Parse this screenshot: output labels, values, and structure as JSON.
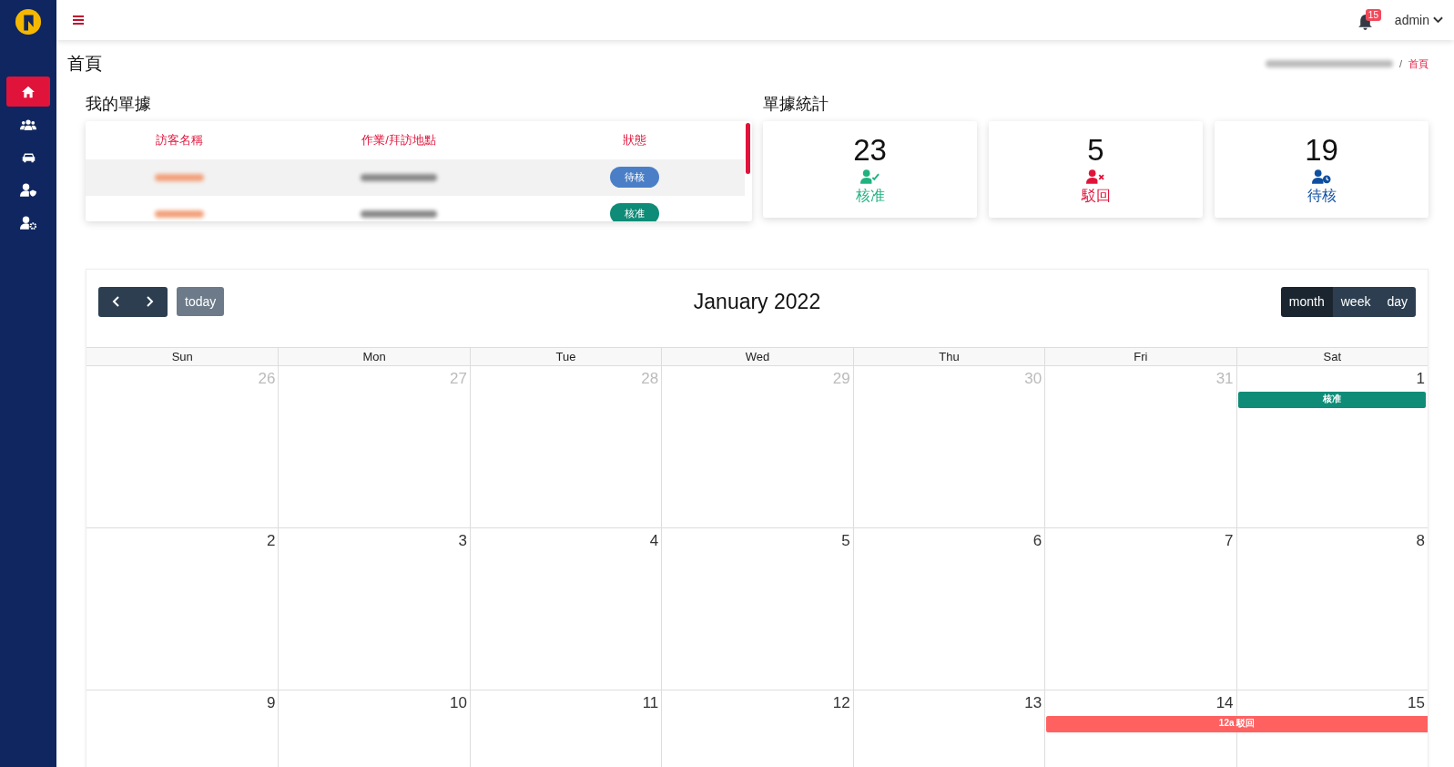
{
  "topbar": {
    "notifications": "15",
    "user": "admin"
  },
  "sidebar": {
    "items": [
      {
        "kind": "home",
        "selected": true
      },
      {
        "kind": "users",
        "selected": false
      },
      {
        "kind": "car",
        "selected": false
      },
      {
        "kind": "shield",
        "selected": false
      },
      {
        "kind": "gear",
        "selected": false
      }
    ]
  },
  "page": {
    "title": "首頁",
    "breadcrumb_separator": "/",
    "breadcrumb_current": "首頁"
  },
  "my_forms": {
    "title": "我的單據",
    "columns": [
      "訪客名稱",
      "作業/拜訪地點",
      "狀態"
    ],
    "rows": [
      {
        "status": "待核",
        "color": "#4a7fc8"
      },
      {
        "status": "核准",
        "color": "#0e8c78"
      }
    ]
  },
  "stats": {
    "title": "單據統計",
    "cards": [
      {
        "value": "23",
        "label": "核准",
        "kind": "approved",
        "color": "#20b27f"
      },
      {
        "value": "5",
        "label": "駁回",
        "kind": "rejected",
        "color": "#e0133a"
      },
      {
        "value": "19",
        "label": "待核",
        "kind": "pending",
        "color": "#0f4fa0"
      }
    ]
  },
  "calendar": {
    "title": "January 2022",
    "today": "today",
    "views": [
      {
        "label": "month",
        "selected": true
      },
      {
        "label": "week",
        "selected": false
      },
      {
        "label": "day",
        "selected": false
      }
    ],
    "weekdays": [
      "Sun",
      "Mon",
      "Tue",
      "Wed",
      "Thu",
      "Fri",
      "Sat"
    ],
    "weeks": [
      {
        "days": [
          {
            "day": "26",
            "muted": true
          },
          {
            "day": "27",
            "muted": true
          },
          {
            "day": "28",
            "muted": true
          },
          {
            "day": "29",
            "muted": true
          },
          {
            "day": "30",
            "muted": true
          },
          {
            "day": "31",
            "muted": true
          },
          {
            "day": "1",
            "muted": false,
            "events": [
              {
                "title": "核准",
                "spans_next_day": false,
                "color": "#0e8c78"
              }
            ]
          }
        ]
      },
      {
        "days": [
          {
            "day": "2",
            "muted": false
          },
          {
            "day": "3",
            "muted": false
          },
          {
            "day": "4",
            "muted": false
          },
          {
            "day": "5",
            "muted": false
          },
          {
            "day": "6",
            "muted": false
          },
          {
            "day": "7",
            "muted": false
          },
          {
            "day": "8",
            "muted": false
          }
        ]
      },
      {
        "days": [
          {
            "day": "9",
            "muted": false
          },
          {
            "day": "10",
            "muted": false
          },
          {
            "day": "11",
            "muted": false
          },
          {
            "day": "12",
            "muted": false
          },
          {
            "day": "13",
            "muted": false
          },
          {
            "day": "14",
            "muted": false,
            "events": [
              {
                "title": "12a 駁回",
                "spans_next_day": true,
                "color": "#ff6161"
              }
            ]
          },
          {
            "day": "15",
            "muted": false
          }
        ]
      }
    ]
  }
}
